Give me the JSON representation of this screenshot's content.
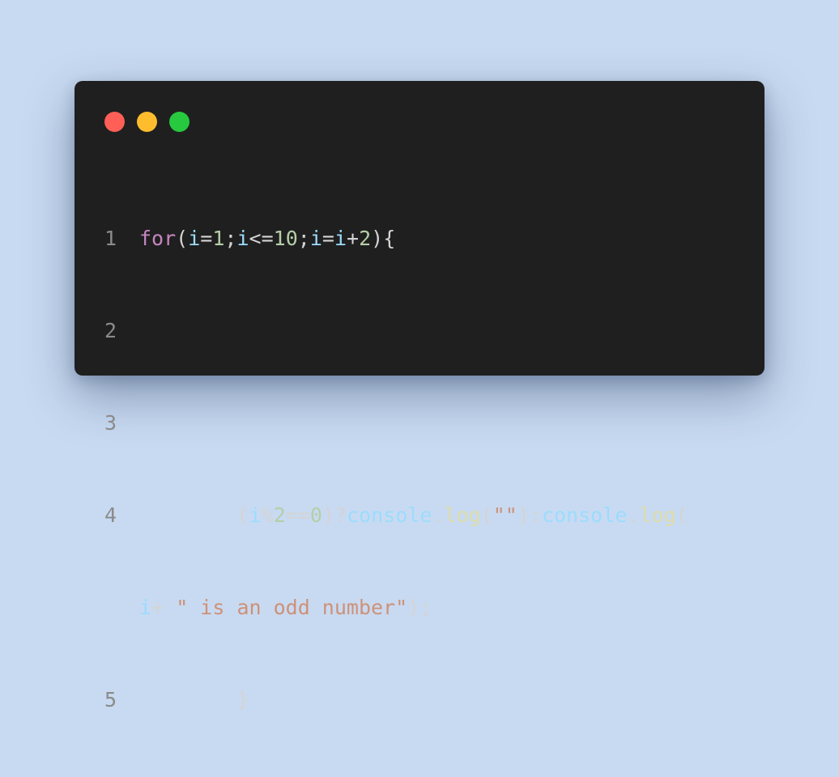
{
  "window": {
    "controls": {
      "close_color": "#ff5f56",
      "minimize_color": "#ffbd2e",
      "maximize_color": "#27c93f"
    }
  },
  "editor": {
    "language": "javascript",
    "lines": [
      {
        "number": "1",
        "text": "for(i=1;i<=10;i=i+2){"
      },
      {
        "number": "2",
        "text": ""
      },
      {
        "number": "3",
        "text": ""
      },
      {
        "number": "4",
        "text": "        (i%2==0)?console.log(\"\"):console.log("
      },
      {
        "number": "",
        "text": "i+ \" is an odd number\");"
      },
      {
        "number": "5",
        "text": "        }"
      }
    ],
    "colors": {
      "background": "#1f1f1f",
      "keyword": "#c586c0",
      "variable": "#9cdcfe",
      "number": "#b5cea8",
      "function": "#dcdcaa",
      "string": "#ce9178",
      "line_number": "#8b8b8b"
    }
  }
}
